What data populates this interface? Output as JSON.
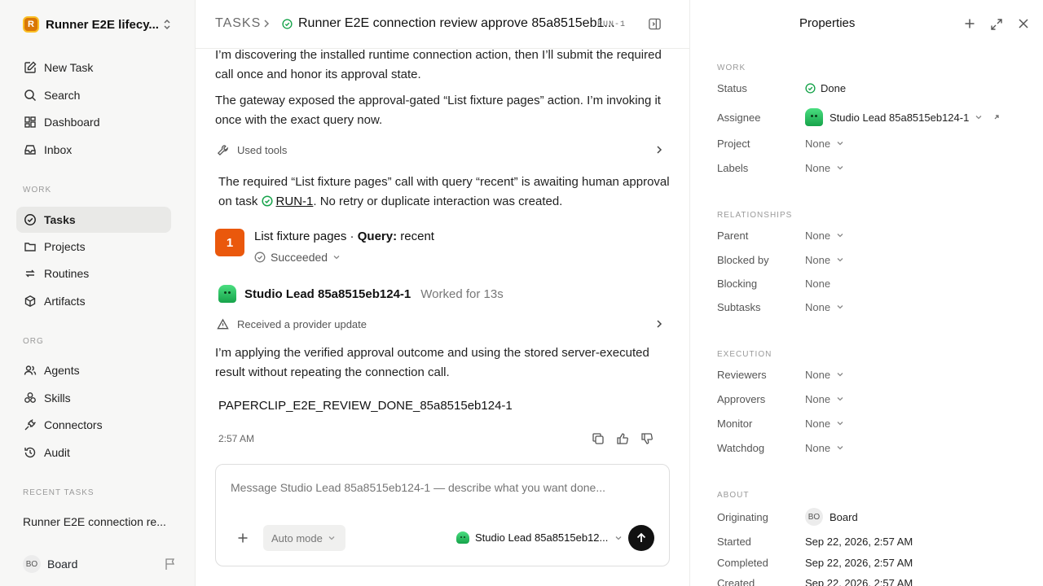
{
  "sidebar": {
    "workspace": {
      "logo": "R",
      "name": "Runner E2E lifecy..."
    },
    "top_nav": [
      {
        "label": "New Task",
        "icon": "edit-icon"
      },
      {
        "label": "Search",
        "icon": "search-icon"
      },
      {
        "label": "Dashboard",
        "icon": "dashboard-icon"
      },
      {
        "label": "Inbox",
        "icon": "inbox-icon"
      }
    ],
    "work_label": "WORK",
    "work_nav": [
      {
        "label": "Tasks",
        "icon": "check-circle-icon",
        "active": true
      },
      {
        "label": "Projects",
        "icon": "folder-icon"
      },
      {
        "label": "Routines",
        "icon": "repeat-icon"
      },
      {
        "label": "Artifacts",
        "icon": "box-icon"
      }
    ],
    "org_label": "ORG",
    "org_nav": [
      {
        "label": "Agents",
        "icon": "users-icon"
      },
      {
        "label": "Skills",
        "icon": "skills-icon"
      },
      {
        "label": "Connectors",
        "icon": "plug-icon"
      },
      {
        "label": "Audit",
        "icon": "history-icon"
      }
    ],
    "recent_label": "RECENT TASKS",
    "recent_item": "Runner E2E connection re...",
    "user": {
      "initials": "BO",
      "name": "Board"
    }
  },
  "header": {
    "section": "TASKS",
    "title": "Runner E2E connection review approve 85a8515eb1...",
    "task_id": "RUN-1"
  },
  "thread": {
    "p1": "I’m discovering the installed runtime connection action, then I’ll submit the required call once and honor its approval state.",
    "p2": "The gateway exposed the approval-gated “List fixture pages” action. I’m invoking it once with the exact query now.",
    "used_tools": "Used tools",
    "p3_a": "The required “List fixture pages” call with query “recent” is awaiting human approval on task ",
    "p3_link": "RUN-1",
    "p3_b": ". No retry or duplicate interaction was created.",
    "call": {
      "badge": "1",
      "action": "List fixture pages ·",
      "query_label": "Query:",
      "query_value": "recent",
      "state": "Succeeded"
    },
    "agent": {
      "name": "Studio Lead 85a8515eb124-1",
      "meta": "Worked for 13s"
    },
    "provider_update": "Received a provider update",
    "p4": "I’m applying the verified approval outcome and using the stored server-executed result without repeating the connection call.",
    "done_token": "PAPERCLIP_E2E_REVIEW_DONE_85a8515eb124-1",
    "timestamp": "2:57 AM"
  },
  "composer": {
    "placeholder": "Message Studio Lead 85a8515eb124-1 — describe what you want done...",
    "mode": "Auto mode",
    "agent": "Studio Lead 85a8515eb12..."
  },
  "properties": {
    "title": "Properties",
    "work_label": "WORK",
    "status_label": "Status",
    "status_value": "Done",
    "assignee_label": "Assignee",
    "assignee_value": "Studio Lead 85a8515eb124-1",
    "project_label": "Project",
    "project_value": "None",
    "labels_label": "Labels",
    "labels_value": "None",
    "relationships_label": "RELATIONSHIPS",
    "parent_label": "Parent",
    "parent_value": "None",
    "blocked_by_label": "Blocked by",
    "blocked_by_value": "None",
    "blocking_label": "Blocking",
    "blocking_value": "None",
    "subtasks_label": "Subtasks",
    "subtasks_value": "None",
    "execution_label": "EXECUTION",
    "reviewers_label": "Reviewers",
    "reviewers_value": "None",
    "approvers_label": "Approvers",
    "approvers_value": "None",
    "monitor_label": "Monitor",
    "monitor_value": "None",
    "watchdog_label": "Watchdog",
    "watchdog_value": "None",
    "about_label": "ABOUT",
    "originating_label": "Originating",
    "originating_initials": "BO",
    "originating_value": "Board",
    "started_label": "Started",
    "started_value": "Sep 22, 2026, 2:57 AM",
    "completed_label": "Completed",
    "completed_value": "Sep 22, 2026, 2:57 AM",
    "created_label": "Created",
    "created_value": "Sep 22, 2026, 2:57 AM"
  },
  "colors": {
    "accent_orange": "#ea580c",
    "done_green": "#16a34a",
    "sidebar_bg": "#f7f7f6"
  }
}
